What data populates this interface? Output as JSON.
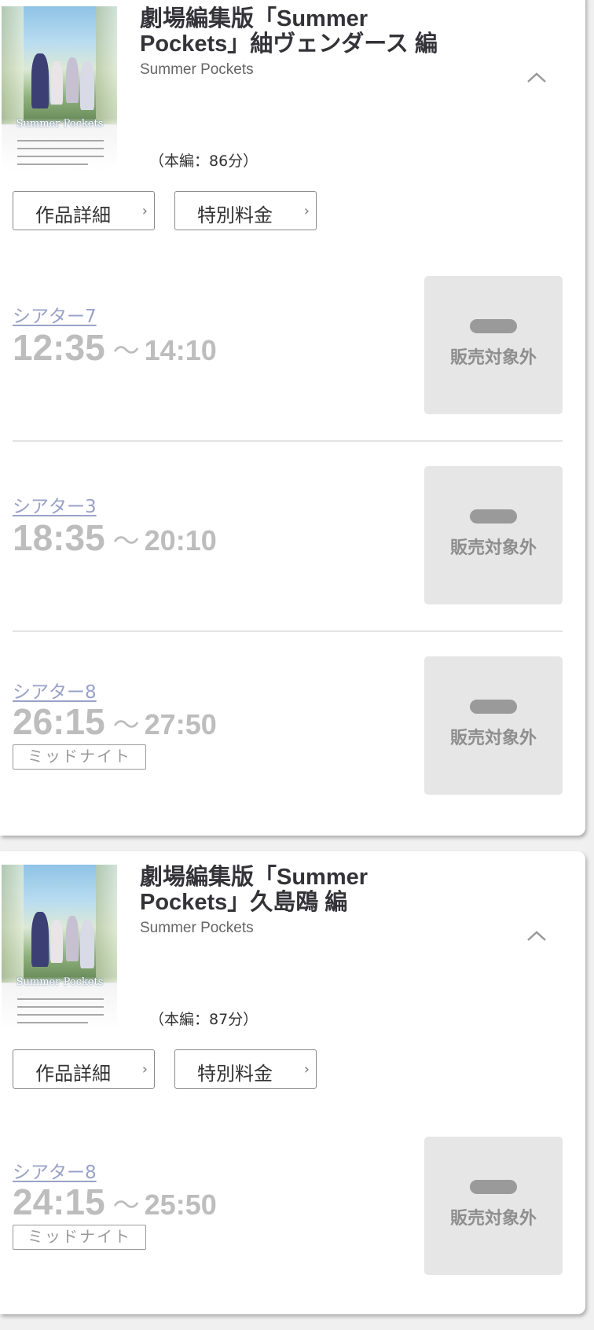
{
  "films": [
    {
      "title": "劇場編集版「Summer Pockets」紬ヴェンダース 編",
      "title_line1": "劇場編集版「Summer",
      "title_line2": "Pockets」紬ヴェンダース 編",
      "subtitle": "Summer Pockets",
      "duration": "（本編：86分）",
      "detail_button": "作品詳細",
      "special_button": "特別料金",
      "showings": [
        {
          "theater": "シアター7",
          "start": "12:35",
          "tilde": "～",
          "end": "14:10",
          "tag": "",
          "status": "販売対象外"
        },
        {
          "theater": "シアター3",
          "start": "18:35",
          "tilde": "～",
          "end": "20:10",
          "tag": "",
          "status": "販売対象外"
        },
        {
          "theater": "シアター8",
          "start": "26:15",
          "tilde": "～",
          "end": "27:50",
          "tag": "ミッドナイト",
          "status": "販売対象外"
        }
      ]
    },
    {
      "title": "劇場編集版「Summer Pockets」久島鴎 編",
      "title_line1": "劇場編集版「Summer",
      "title_line2": "Pockets」久島鴎 編",
      "subtitle": "Summer Pockets",
      "duration": "（本編：87分）",
      "detail_button": "作品詳細",
      "special_button": "特別料金",
      "showings": [
        {
          "theater": "シアター8",
          "start": "24:15",
          "tilde": "～",
          "end": "25:50",
          "tag": "ミッドナイト",
          "status": "販売対象外"
        }
      ]
    }
  ],
  "poster_logo": "Summer Pockets",
  "colors": {
    "theater_link": "#9aa2c8",
    "time_disabled": "#bdbdbd",
    "sale_box": "#e6e6e6",
    "title": "#333338"
  },
  "icons": {
    "collapse": "chevron-up-icon",
    "button_arrow": "chevron-right-icon"
  }
}
